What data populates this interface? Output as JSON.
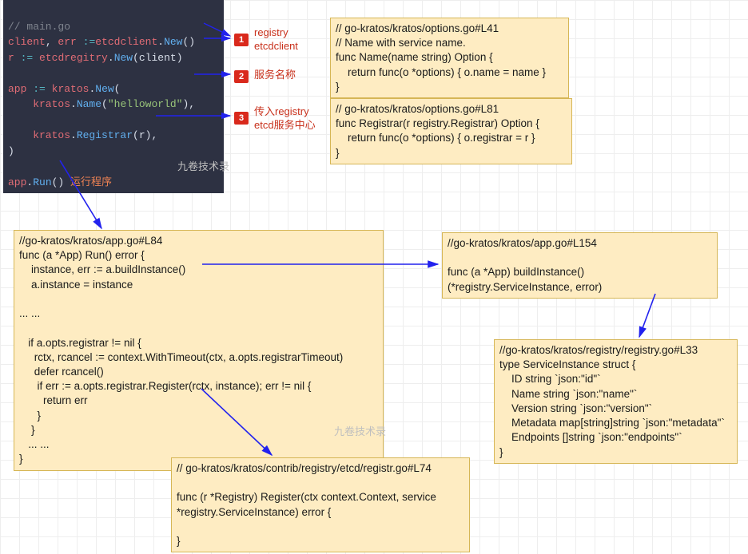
{
  "watermarks": {
    "w1": "九卷技术录",
    "w2": "九卷技术录"
  },
  "mainCode": {
    "l1_cmt": "// main.go",
    "l2a": "client",
    "l2b": "err",
    "l2c": ":=",
    "l2d": "etcdclient",
    "l2e": "New",
    "l2f": "()",
    "l3a": "r",
    "l3b": ":=",
    "l3c": "etcdregitry",
    "l3d": "New",
    "l3e": "(client)",
    "l4a": "app",
    "l4b": ":=",
    "l4c": "kratos",
    "l4d": "New",
    "l4e": "(",
    "l5a": "    kratos",
    "l5b": "Name",
    "l5c": "(",
    "l5d": "\"helloworld\"",
    "l5e": "),",
    "l6a": "    kratos",
    "l6b": "Registrar",
    "l6c": "(r),",
    "l7": ")",
    "l8a": "app",
    "l8b": "Run",
    "l8c": "()",
    "l8_cn": " 运行程序"
  },
  "badges": {
    "b1": "1",
    "b2": "2",
    "b3": "3"
  },
  "redLabels": {
    "r1": "registry\netcdclient",
    "r2": "服务名称",
    "r3": "传入registry\netcd服务中心"
  },
  "boxes": {
    "optName": "// go-kratos/kratos/options.go#L41\n// Name with service name.\nfunc Name(name string) Option {\n    return func(o *options) { o.name = name }\n}",
    "optRegistrar": "// go-kratos/kratos/options.go#L81\nfunc Registrar(r registry.Registrar) Option {\n    return func(o *options) { o.registrar = r }\n}",
    "appRun": "//go-kratos/kratos/app.go#L84\nfunc (a *App) Run() error {\n    instance, err := a.buildInstance()\n    a.instance = instance\n\n... ...\n\n   if a.opts.registrar != nil {\n     rctx, rcancel := context.WithTimeout(ctx, a.opts.registrarTimeout)\n     defer rcancel()\n      if err := a.opts.registrar.Register(rctx, instance); err != nil {\n        return err\n      }\n    }\n   ... ...\n}",
    "buildInst": "//go-kratos/kratos/app.go#L154\n\nfunc (a *App) buildInstance() (*registry.ServiceInstance, error)",
    "serviceInst": "//go-kratos/kratos/registry/registry.go#L33\ntype ServiceInstance struct {\n    ID string `json:\"id\"`\n    Name string `json:\"name\"`\n    Version string `json:\"version\"`\n    Metadata map[string]string `json:\"metadata\"`\n    Endpoints []string `json:\"endpoints\"`\n}",
    "etcdReg": "// go-kratos/kratos/contrib/registry/etcd/registr.go#L74\n\nfunc (r *Registry) Register(ctx context.Context, service *registry.ServiceInstance) error {\n\n}"
  }
}
